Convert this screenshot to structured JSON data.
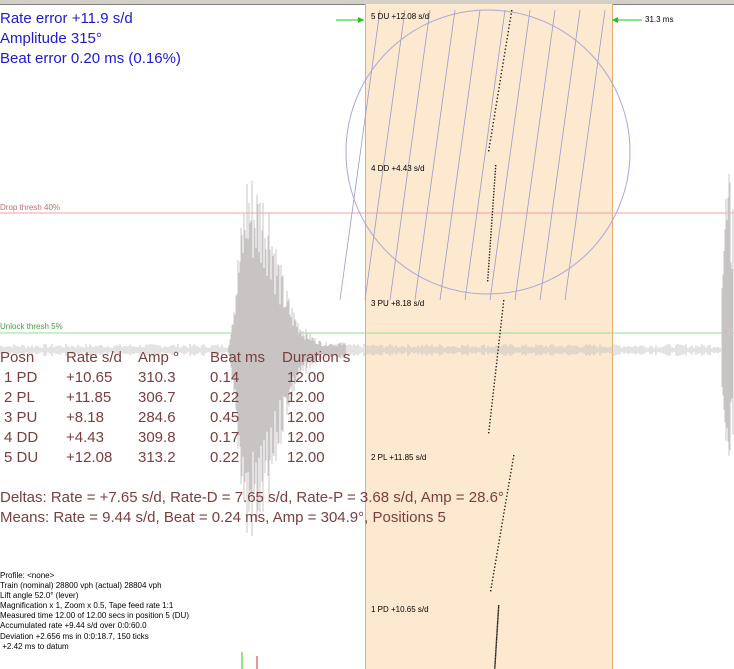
{
  "header": {
    "rate_error": "Rate error  +11.9 s/d",
    "amplitude": "Amplitude 315°",
    "beat_error": "Beat error 0.20 ms (0.16%)"
  },
  "thresholds": {
    "drop": "Drop thresh 40%",
    "unlock": "Unlock thresh 5%"
  },
  "marker_right_label": "31.3 ms",
  "positions_display": [
    {
      "label": "5 DU  +12.08 s/d"
    },
    {
      "label": "4 DD  +4.43 s/d"
    },
    {
      "label": "3 PU  +8.18 s/d"
    },
    {
      "label": "2 PL  +11.85 s/d"
    },
    {
      "label": "1 PD  +10.65 s/d"
    }
  ],
  "table": {
    "headers": [
      "Posn",
      "Rate s/d",
      "Amp °",
      "Beat ms",
      "Duration s"
    ],
    "rows": [
      [
        "1 PD",
        "+10.65",
        "310.3",
        "0.14",
        "12.00"
      ],
      [
        "2 PL",
        "+11.85",
        "306.7",
        "0.22",
        "12.00"
      ],
      [
        "3 PU",
        "+8.18",
        "284.6",
        "0.45",
        "12.00"
      ],
      [
        "4 DD",
        "+4.43",
        "309.8",
        "0.17",
        "12.00"
      ],
      [
        "5 DU",
        "+12.08",
        "313.2",
        "0.22",
        "12.00"
      ]
    ]
  },
  "deltas": "Deltas:   Rate = +7.65 s/d, Rate-D = 7.65 s/d, Rate-P = 3.68 s/d, Amp =  28.6°",
  "means": "Means:   Rate = 9.44 s/d, Beat = 0.24 ms, Amp = 304.9°, Positions 5",
  "info_lines": [
    "Profile: <none>",
    "Train (nominal) 28800 vph (actual) 28804 vph",
    "Lift angle  52.0° (lever)",
    "Magnification x 1, Zoom x 0.5, Tape feed rate 1:1",
    "Measured time 12.00 of 12.00 secs in position 5 (DU)",
    "Accumulated rate +9.44 s/d over 0:0:60.0",
    "Deviation +2.656 ms in 0:0:18.7, 150 ticks",
    " +2.42 ms to datum"
  ],
  "colors": {
    "header_text": "#1b1bd0",
    "stats_text": "#7a3e3e",
    "band_fill": "#fce9cf",
    "drop_line": "#f0a0a0",
    "unlock_line": "#90e090",
    "waveform": "#c8c4c4",
    "marker_arrow": "#22c322",
    "circle": "#a8a8d8"
  }
}
